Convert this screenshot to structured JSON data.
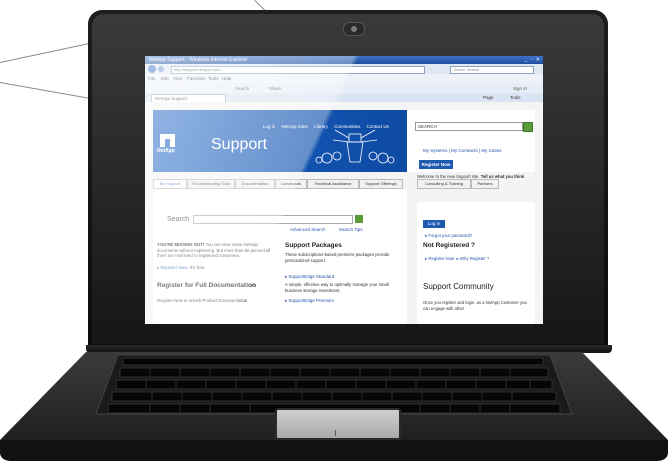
{
  "browser": {
    "title": "NetApp Support - Windows Internet Explorer",
    "url": "http://support.netapp.com/",
    "search_placeholder": "Yahoo! Search",
    "window_controls": "_ ▫ ✕",
    "menu": [
      "File",
      "Edit",
      "View",
      "Favorites",
      "Tools",
      "Help"
    ],
    "toolbar_search": "Search",
    "toolbar_share": "Share",
    "sign_in": "Sign In",
    "tab_label": "NetApp Support",
    "page_menu": "Page",
    "tools_menu": "Tools"
  },
  "header": {
    "links": [
      "Log in",
      "NetApp Sites",
      "Library",
      "Communities",
      "Contact Us"
    ],
    "logo_text": "NetApp",
    "title": "Support",
    "search_value": "SEARCH",
    "account_links": "My Systems  |  My Contracts  |  My Cases",
    "register_button": "Register Now",
    "welcome_text": "Welcome to the new Support site.",
    "welcome_bold": "Tell us what you think"
  },
  "nav_tabs": [
    "My Support",
    "Troubleshooting Tools",
    "Documentation",
    "Downloads",
    "Technical Assistance",
    "Support Offerings",
    "Consulting & Training",
    "Partners"
  ],
  "main": {
    "search_label": "Search",
    "advanced_search": "Advanced Search",
    "search_tips": "Search Tips",
    "missing_bold": "YOU'RE MISSING OUT!",
    "missing_text": "You can view some NetApp documents without registering. But more than 80 percent of them are restricted to registered customers.",
    "register_link": "Register Now.",
    "register_suffix": "It's free.",
    "packages_title": "Support Packages",
    "packages_text": "These subscriptions-based premiere packages provide personalized support.",
    "package1": "SupportEdge Standard",
    "package1_text": "A simple, effective way to optimally manage your small business storage investment.",
    "package2": "SupportEdge Premium",
    "reg_full_title": "Register for Full Documentation",
    "reg_full_text": "Register Now to unlock Product Documentation"
  },
  "sidebar": {
    "login_button": "Log In",
    "forgot": "Forgot your password?",
    "not_registered": "Not Registered ?",
    "register_now": "Register Now",
    "why_register": "Why Register ?",
    "community_title": "Support Community",
    "community_text": "Once you register and login, as a NetApp Customer you can engage with other"
  },
  "colors": {
    "brand_blue": "#1559bb",
    "link_blue": "#2255aa",
    "go_green": "#5b9a3a"
  }
}
